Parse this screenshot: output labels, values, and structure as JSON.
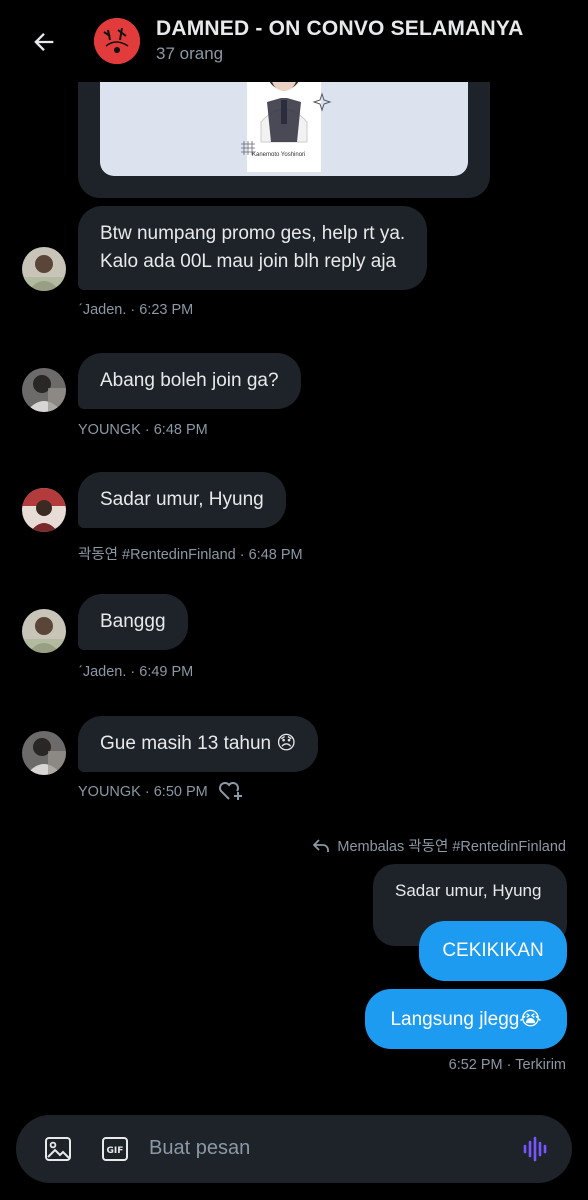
{
  "header": {
    "title": "DAMNED - ON CONVO SELAMANYA",
    "members": "37 orang"
  },
  "card": {
    "caption": "Kanemoto Yoshinori"
  },
  "messages": [
    {
      "line1": "Btw numpang promo ges, help rt ya.",
      "line2": "Kalo ada 00L mau join blh reply aja",
      "meta": "ˊJaden. · 6:23 PM"
    },
    {
      "text": "Abang boleh join ga?",
      "meta": "YOUNGK · 6:48 PM"
    },
    {
      "text": "Sadar umur, Hyung",
      "meta": "곽동연 #RentedinFinland · 6:48 PM"
    },
    {
      "text": "Banggg",
      "meta": "ˊJaden. · 6:49 PM"
    },
    {
      "text": "Gue masih 13 tahun 😞",
      "meta": "YOUNGK · 6:50 PM"
    }
  ],
  "reply": {
    "note": "Membalas 곽동연 #RentedinFinland",
    "quoted": "Sadar umur, Hyung"
  },
  "sent": [
    {
      "text": "CEKIKIKAN"
    },
    {
      "text": "Langsung jlegg😭"
    }
  ],
  "sent_meta": "6:52 PM · Terkirim",
  "composer": {
    "placeholder": "Buat pesan"
  },
  "colors": {
    "background": "#000000",
    "bubble_in": "#1e2329",
    "bubble_out": "#1d9bf0",
    "muted": "#8b98a5",
    "voice_accent": "#7856ff"
  }
}
